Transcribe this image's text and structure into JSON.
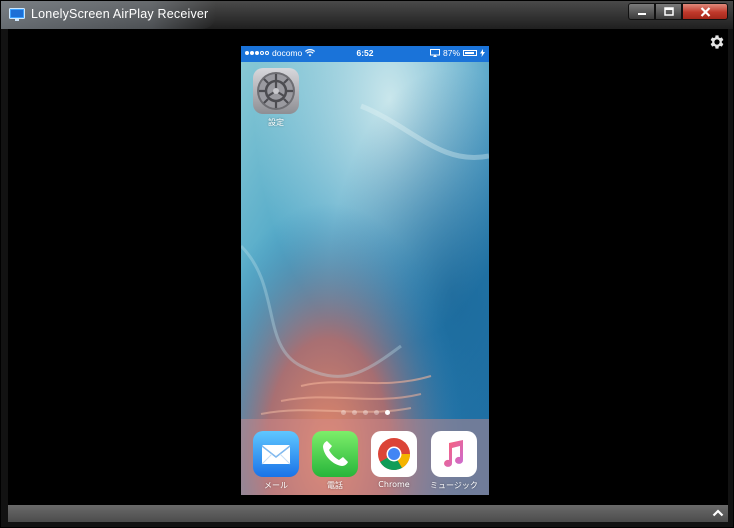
{
  "window": {
    "title": "LonelyScreen AirPlay Receiver",
    "accent": "#1a73d9"
  },
  "icons": {
    "app": "monitor-icon",
    "minimize": "minimize-icon",
    "maximize": "maximize-icon",
    "close": "close-icon",
    "settings": "gear-icon",
    "expand": "chevron-up-icon"
  },
  "phone": {
    "status_bar": {
      "carrier": "docomo",
      "time": "6:52",
      "battery": "87%",
      "battery_level": 0.87,
      "signal_bars_filled": 3,
      "signal_bars_total": 5
    },
    "home_apps": [
      {
        "label": "設定",
        "icon": "settings-app-icon"
      }
    ],
    "page_dots": {
      "count": 5,
      "active_index": 4
    },
    "dock_apps": [
      {
        "label": "メール",
        "icon": "mail-app-icon"
      },
      {
        "label": "電話",
        "icon": "phone-app-icon"
      },
      {
        "label": "Chrome",
        "icon": "chrome-app-icon"
      },
      {
        "label": "ミュージック",
        "icon": "music-app-icon"
      }
    ]
  }
}
